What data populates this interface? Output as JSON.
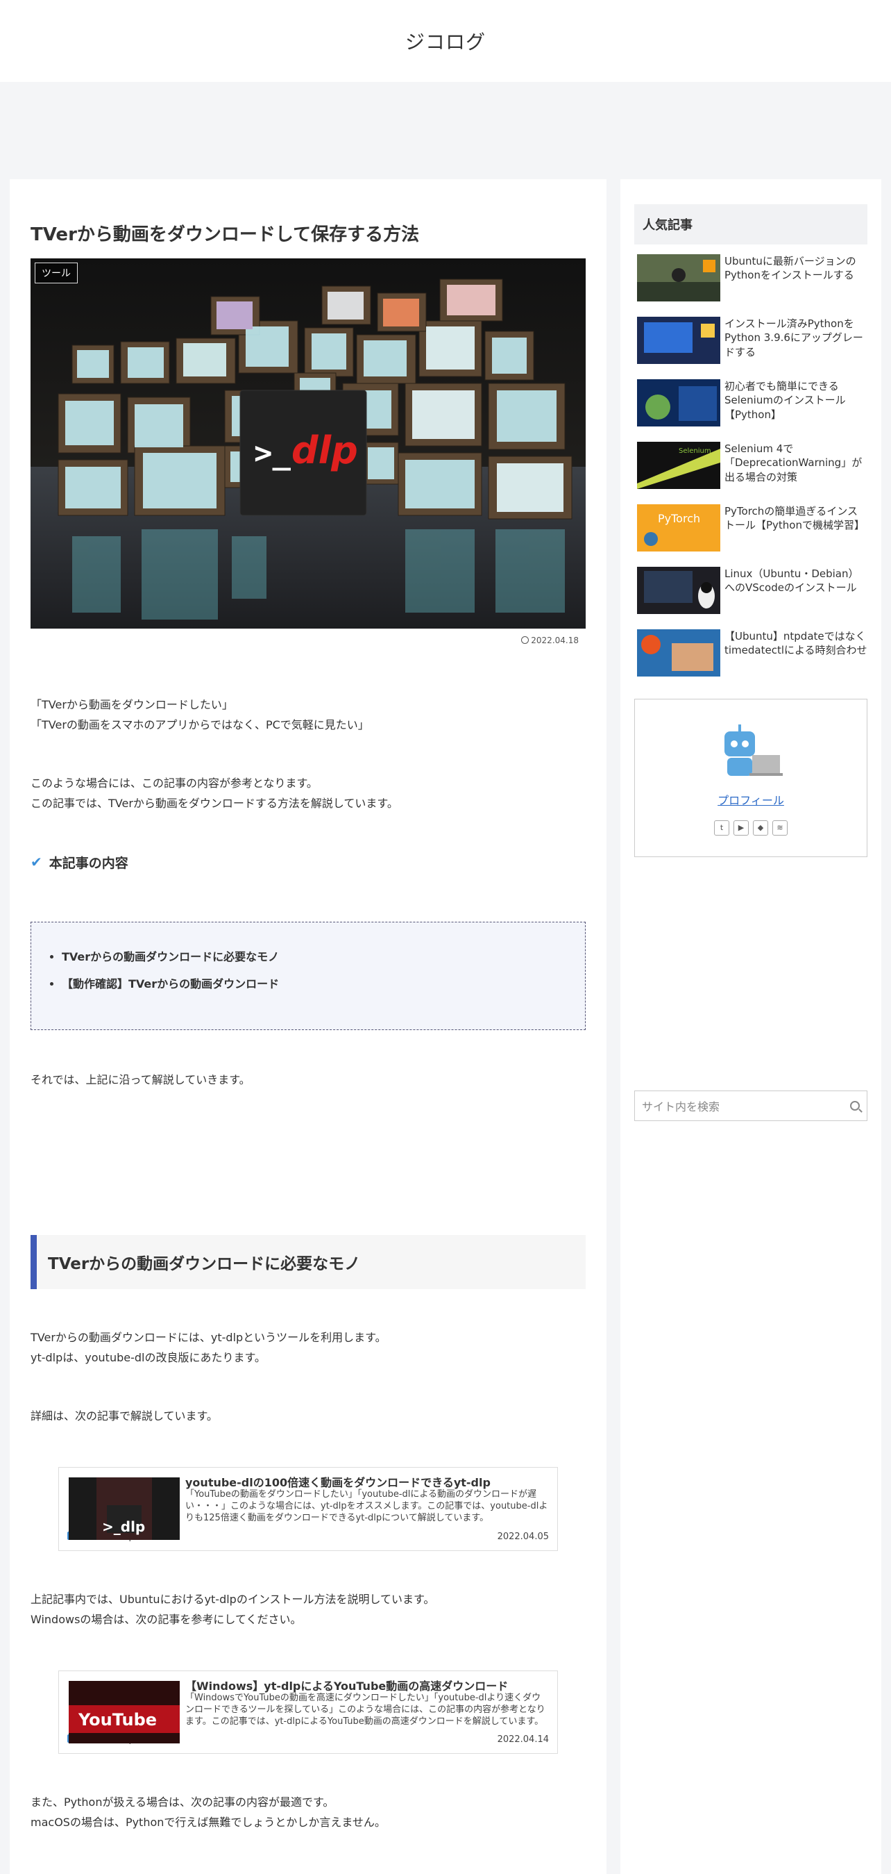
{
  "site": {
    "title": "ジコログ"
  },
  "article": {
    "title": "TVerから動画をダウンロードして保存する方法",
    "category": "ツール",
    "date": "2022.04.18",
    "intro": [
      "「TVerから動画をダウンロードしたい」",
      "「TVerの動画をスマホのアプリからではなく、PCで気軽に見たい」"
    ],
    "lead": [
      "このような場合には、この記事の内容が参考となります。",
      "この記事では、TVerから動画をダウンロードする方法を解説しています。"
    ],
    "toc_heading": "本記事の内容",
    "toc": [
      "TVerからの動画ダウンロードに必要なモノ",
      "【動作確認】TVerからの動画ダウンロード"
    ],
    "transition": "それでは、上記に沿って解説していきます。",
    "section1": {
      "heading": "TVerからの動画ダウンロードに必要なモノ",
      "p1": [
        "TVerからの動画ダウンロードには、yt-dlpというツールを利用します。",
        "yt-dlpは、youtube-dlの改良版にあたります。"
      ],
      "p2": "詳細は、次の記事で解説しています。",
      "p3": [
        "上記記事内では、Ubuntuにおけるyt-dlpのインストール方法を説明しています。",
        "Windowsの場合は、次の記事を参考にしてください。"
      ],
      "p4": [
        "また、Pythonが扱える場合は、次の記事の内容が最適です。",
        "macOSの場合は、Pythonで行えば無難でしょうとかしか言えません。"
      ]
    }
  },
  "cards": [
    {
      "title": "youtube-dlの100倍速く動画をダウンロードできるyt-dlp",
      "snippet": "「YouTubeの動画をダウンロードしたい」「youtube-dlによる動画のダウンロードが遅い・・・」このような場合には、yt-dlpをオススメします。この記事では、youtube-dlよりも125倍速く動画をダウンロードできるyt-dlpについて解説しています。",
      "site": "self-development.info",
      "date": "2022.04.05",
      "thumb_text": ">_dlp"
    },
    {
      "title": "【Windows】yt-dlpによるYouTube動画の高速ダウンロード",
      "snippet": "「WindowsでYouTubeの動画を高速にダウンロードしたい」「youtube-dlより速くダウンロードできるツールを探している」このような場合には、この記事の内容が参考となります。この記事では、yt-dlpによるYouTube動画の高速ダウンロードを解説しています。",
      "site": "self-development.info",
      "date": "2022.04.14",
      "thumb_text": "YouTube"
    }
  ],
  "eyecatch": {
    "logo_prompt": ">_",
    "logo_text": "dlp"
  },
  "sidebar": {
    "popular_title": "人気記事",
    "popular": [
      "Ubuntuに最新バージョンのPythonをインストールする",
      "インストール済みPythonをPython 3.9.6にアップグレードする",
      "初心者でも簡単にできるSeleniumのインストール【Python】",
      "Selenium 4で「DeprecationWarning」が出る場合の対策",
      "PyTorchの簡単過ぎるインストール【Pythonで機械学習】",
      "Linux（Ubuntu・Debian）へのVScodeのインストール",
      "【Ubuntu】ntpdateではなくtimedatectlによる時刻合わせ"
    ],
    "thumb_labels": [
      "",
      "",
      "",
      "Selenium",
      "PyTorch",
      "",
      ""
    ],
    "profile_link": "プロフィール",
    "socials": [
      "t",
      "▶",
      "◆",
      "≋"
    ],
    "search_placeholder": "サイト内を検索"
  }
}
